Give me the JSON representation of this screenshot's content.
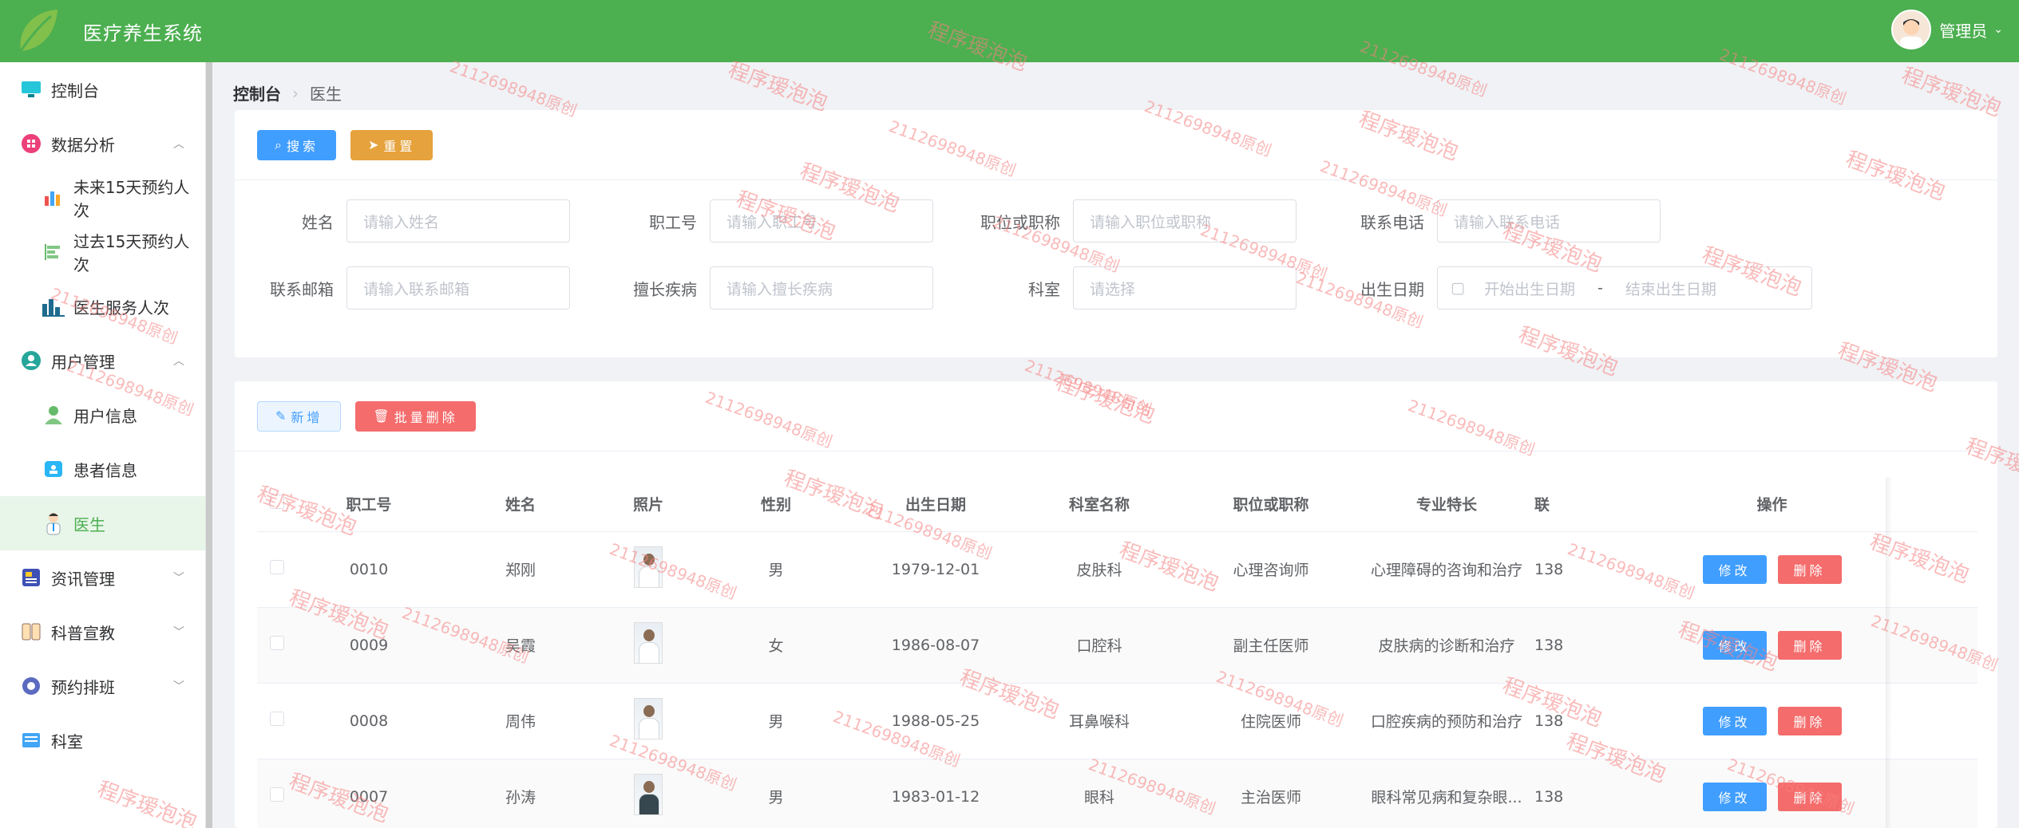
{
  "header": {
    "app_title": "医疗养生系统",
    "user_name": "管理员"
  },
  "sidebar": {
    "items": [
      {
        "label": "控制台",
        "icon": "monitor-icon"
      },
      {
        "label": "数据分析",
        "icon": "grid-icon"
      },
      {
        "label": "未来15天预约人次",
        "icon": "bar-chart-icon"
      },
      {
        "label": "过去15天预约人次",
        "icon": "horizontal-bar-icon"
      },
      {
        "label": "医生服务人次",
        "icon": "column-chart-icon"
      },
      {
        "label": "用户管理",
        "icon": "user-circle-icon"
      },
      {
        "label": "用户信息",
        "icon": "user-icon"
      },
      {
        "label": "患者信息",
        "icon": "id-card-icon"
      },
      {
        "label": "医生",
        "icon": "doctor-icon"
      },
      {
        "label": "资讯管理",
        "icon": "news-icon"
      },
      {
        "label": "科普宣教",
        "icon": "book-icon"
      },
      {
        "label": "预约排班",
        "icon": "gear-icon"
      },
      {
        "label": "科室",
        "icon": "department-icon"
      }
    ]
  },
  "breadcrumb": {
    "root": "控制台",
    "current": "医生"
  },
  "search": {
    "search_btn": "搜索",
    "reset_btn": "重置",
    "fields": {
      "name": {
        "label": "姓名",
        "placeholder": "请输入姓名"
      },
      "staff_no": {
        "label": "职工号",
        "placeholder": "请输入职工号"
      },
      "title": {
        "label": "职位或职称",
        "placeholder": "请输入职位或职称"
      },
      "phone": {
        "label": "联系电话",
        "placeholder": "请输入联系电话"
      },
      "email": {
        "label": "联系邮箱",
        "placeholder": "请输入联系邮箱"
      },
      "specialty": {
        "label": "擅长疾病",
        "placeholder": "请输入擅长疾病"
      },
      "department": {
        "label": "科室",
        "placeholder": "请选择"
      },
      "birth": {
        "label": "出生日期",
        "start": "开始出生日期",
        "sep": "-",
        "end": "结束出生日期"
      }
    }
  },
  "toolbar": {
    "add_btn": "新增",
    "batch_delete_btn": "批量删除"
  },
  "table": {
    "headers": [
      "职工号",
      "姓名",
      "照片",
      "性别",
      "出生日期",
      "科室名称",
      "职位或职称",
      "专业特长",
      "联",
      "操作"
    ],
    "edit_label": "修改",
    "delete_label": "删除",
    "rows": [
      {
        "staff_no": "0010",
        "name": "郑刚",
        "gender": "男",
        "birth": "1979-12-01",
        "dept": "皮肤科",
        "title": "心理咨询师",
        "specialty": "心理障碍的咨询和治疗",
        "phone": "138"
      },
      {
        "staff_no": "0009",
        "name": "吴霞",
        "gender": "女",
        "birth": "1986-08-07",
        "dept": "口腔科",
        "title": "副主任医师",
        "specialty": "皮肤病的诊断和治疗",
        "phone": "138"
      },
      {
        "staff_no": "0008",
        "name": "周伟",
        "gender": "男",
        "birth": "1988-05-25",
        "dept": "耳鼻喉科",
        "title": "住院医师",
        "specialty": "口腔疾病的预防和治疗",
        "phone": "138"
      },
      {
        "staff_no": "0007",
        "name": "孙涛",
        "gender": "男",
        "birth": "1983-01-12",
        "dept": "眼科",
        "title": "主治医师",
        "specialty": "眼科常见病和复杂眼...",
        "phone": "138"
      }
    ]
  },
  "watermark": {
    "text_a": "程序瑷泡泡",
    "text_b": "2112698948原创"
  },
  "colors": {
    "header_green": "#4caf50",
    "primary": "#409eff",
    "warning": "#e6a23c",
    "danger": "#f56c6c"
  }
}
